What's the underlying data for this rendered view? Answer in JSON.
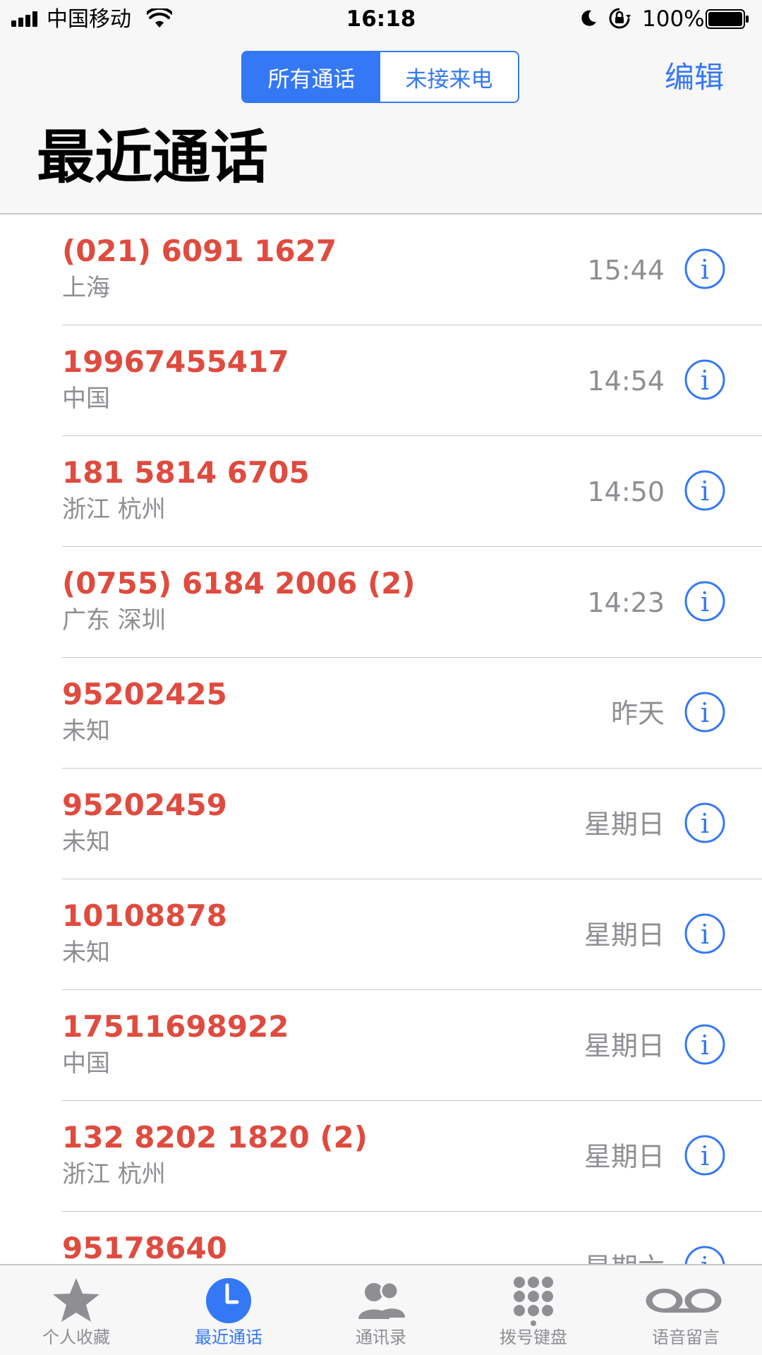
{
  "status_bar": {
    "carrier": "中国移动",
    "time": "16:18",
    "battery": "100%"
  },
  "header": {
    "segments": [
      "所有通话",
      "未接来电"
    ],
    "active_segment": 0,
    "edit_label": "编辑",
    "title": "最近通话"
  },
  "calls": [
    {
      "number": "(021) 6091 1627",
      "location": "上海",
      "time": "15:44"
    },
    {
      "number": "19967455417",
      "location": "中国",
      "time": "14:54"
    },
    {
      "number": "181 5814 6705",
      "location": "浙江 杭州",
      "time": "14:50"
    },
    {
      "number": "(0755) 6184 2006 (2)",
      "location": "广东 深圳",
      "time": "14:23"
    },
    {
      "number": "95202425",
      "location": "未知",
      "time": "昨天"
    },
    {
      "number": "95202459",
      "location": "未知",
      "time": "星期日"
    },
    {
      "number": "10108878",
      "location": "未知",
      "time": "星期日"
    },
    {
      "number": "17511698922",
      "location": "中国",
      "time": "星期日"
    },
    {
      "number": "132 8202 1820 (2)",
      "location": "浙江 杭州",
      "time": "星期日"
    },
    {
      "number": "95178640",
      "location": "",
      "time": "星期六"
    }
  ],
  "tab_bar": {
    "tabs": [
      {
        "label": "个人收藏",
        "icon": "star-icon"
      },
      {
        "label": "最近通话",
        "icon": "clock-icon"
      },
      {
        "label": "通讯录",
        "icon": "contacts-icon"
      },
      {
        "label": "拨号键盘",
        "icon": "keypad-icon"
      },
      {
        "label": "语音留言",
        "icon": "voicemail-icon"
      }
    ],
    "active_tab": 1
  },
  "colors": {
    "accent": "#3478f6",
    "missed_call": "#df4b3f",
    "secondary_text": "#8e8e93"
  }
}
